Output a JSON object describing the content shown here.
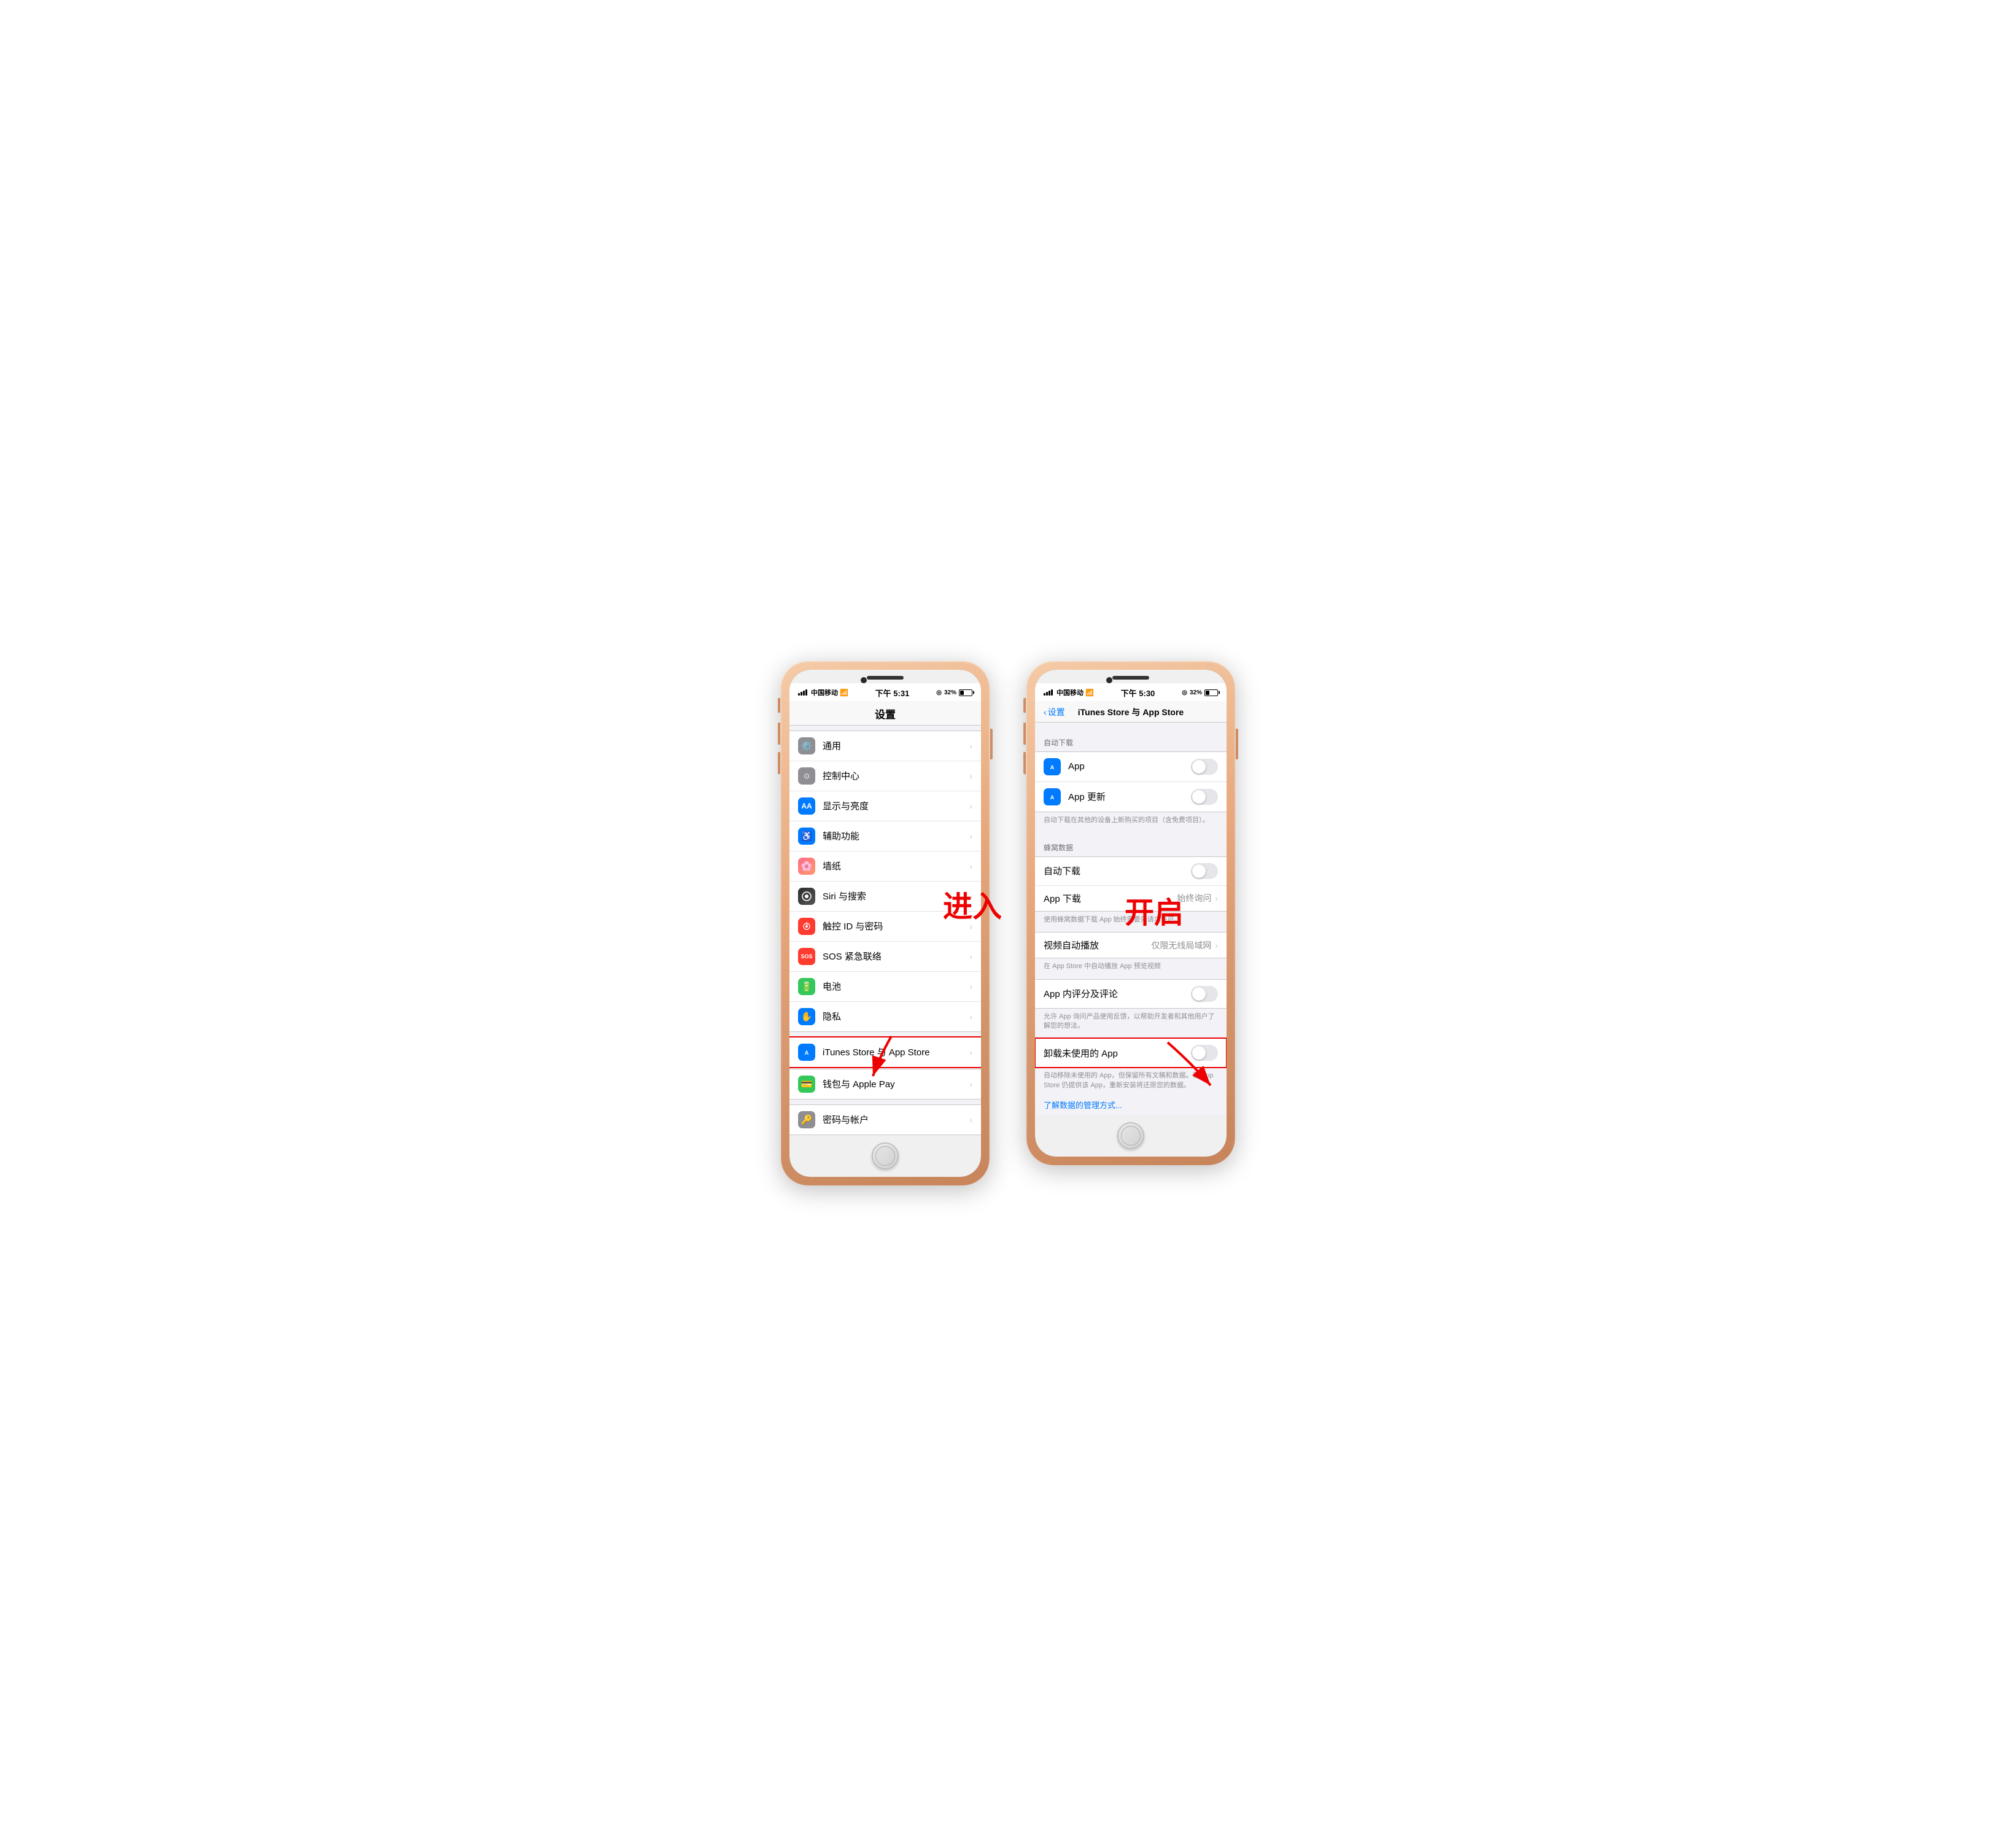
{
  "phone1": {
    "status": {
      "carrier": "中国移动",
      "wifi": "WiFi",
      "time": "下午 5:31",
      "location": "◎",
      "battery": "32%"
    },
    "title": "设置",
    "annotation": "进入",
    "items": [
      {
        "icon": "⚙️",
        "iconBg": "#8e8e93",
        "label": "通用",
        "hasArrow": true
      },
      {
        "icon": "⊙",
        "iconBg": "#8e8e93",
        "label": "控制中心",
        "hasArrow": true
      },
      {
        "icon": "AA",
        "iconBg": "#007aff",
        "label": "显示与亮度",
        "hasArrow": true
      },
      {
        "icon": "♿",
        "iconBg": "#007aff",
        "label": "辅助功能",
        "hasArrow": true
      },
      {
        "icon": "🌸",
        "iconBg": "#ff6b8a",
        "label": "墙纸",
        "hasArrow": true
      },
      {
        "icon": "◉",
        "iconBg": "#2c2c2e",
        "label": "Siri 与搜索",
        "hasArrow": true
      },
      {
        "icon": "◉",
        "iconBg": "#ff3b30",
        "label": "触控 ID 与密码",
        "hasArrow": true
      },
      {
        "icon": "SOS",
        "iconBg": "#ff3b30",
        "label": "SOS 紧急联络",
        "hasArrow": true
      },
      {
        "icon": "▬",
        "iconBg": "#34c759",
        "label": "电池",
        "hasArrow": true
      },
      {
        "icon": "✋",
        "iconBg": "#007aff",
        "label": "隐私",
        "hasArrow": true
      }
    ],
    "highlighted": {
      "icon": "🎵",
      "iconBg": "#007aff",
      "label": "iTunes Store 与 App Store",
      "hasArrow": true
    },
    "extra": [
      {
        "icon": "💳",
        "iconBg": "#34c759",
        "label": "钱包与 Apple Pay",
        "hasArrow": true
      }
    ],
    "bottom": [
      {
        "icon": "🔑",
        "iconBg": "#8e8e93",
        "label": "密码与帐户",
        "hasArrow": true
      }
    ]
  },
  "phone2": {
    "status": {
      "carrier": "中国移动",
      "wifi": "WiFi",
      "time": "下午 5:30",
      "location": "◎",
      "battery": "32%"
    },
    "back": "设置",
    "title": "iTunes Store 与 App Store",
    "annotation": "开启",
    "sections": [
      {
        "header": "自动下载",
        "items": [
          {
            "icon": "A",
            "iconBg": "#007aff",
            "label": "App",
            "toggle": false,
            "hasArrow": false
          },
          {
            "icon": "A",
            "iconBg": "#007aff",
            "label": "App 更新",
            "toggle": false,
            "hasArrow": false
          }
        ],
        "desc": "自动下载在其他的设备上新购买的项目（含免费项目）。"
      },
      {
        "header": "蜂窝数据",
        "items": [
          {
            "label": "自动下载",
            "toggle": false,
            "hasArrow": false
          },
          {
            "label": "App 下载",
            "value": "始终询问",
            "hasArrow": true
          }
        ],
        "desc": "使用蜂窝数据下载 App 始终需要先请求许可。"
      },
      {
        "header": "",
        "items": [
          {
            "label": "视频自动播放",
            "value": "仅限无线局域网",
            "hasArrow": true
          }
        ],
        "desc": "在 App Store 中自动播放 App 预览视频"
      },
      {
        "header": "",
        "items": [
          {
            "label": "App 内评分及评论",
            "toggle": false,
            "hasArrow": false
          }
        ],
        "desc": "允许 App 询问产品使用反馈，以帮助开发者和其他用户了解您的想法。"
      },
      {
        "header": "",
        "highlighted": true,
        "items": [
          {
            "label": "卸载未使用的 App",
            "toggle": false,
            "hasArrow": false,
            "highlighted": true
          }
        ],
        "desc": "自动移除未使用的 App，但保留所有文稿和数据。若 App Store 仍提供该 App，重新安装将还原您的数据。"
      }
    ],
    "footer": "了解数据的管理方式..."
  }
}
